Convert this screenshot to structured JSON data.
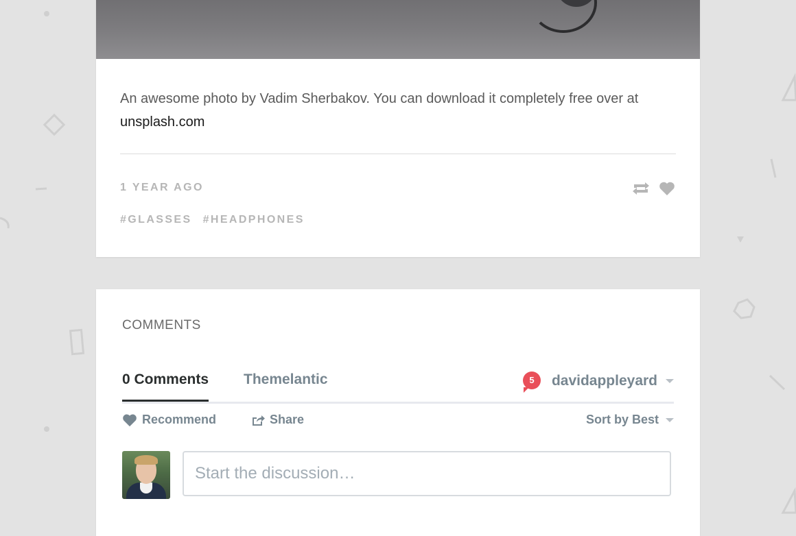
{
  "post": {
    "description": "An awesome photo by Vadim Sherbakov. You can download it completely free over at",
    "link_text": "unsplash.com",
    "time": "1 YEAR AGO",
    "tags": [
      "#GLASSES",
      "#HEADPHONES"
    ],
    "icons": {
      "retweet": "retweet-icon",
      "like": "heart-icon"
    }
  },
  "comments": {
    "heading": "COMMENTS",
    "tab_comments": "0 Comments",
    "tab_org": "Themelantic",
    "notification_count": "5",
    "username": "davidappleyard",
    "recommend_label": "Recommend",
    "share_label": "Share",
    "sort_label": "Sort by Best",
    "input_placeholder": "Start the discussion…"
  },
  "colors": {
    "background": "#e3e3e3",
    "badge": "#e94f59",
    "muted_text": "#b6b6b6",
    "disqus_text": "#778690"
  }
}
